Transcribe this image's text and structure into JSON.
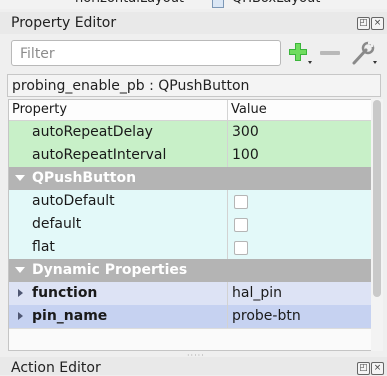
{
  "top_strip": {
    "tab1": "horizontalLayout",
    "tab2": "QHBoxLayout"
  },
  "property_editor": {
    "title": "Property Editor",
    "filter_placeholder": "Filter",
    "object_label": "probing_enable_pb : QPushButton",
    "columns": {
      "property": "Property",
      "value": "Value"
    },
    "rows": [
      {
        "name": "autoRepeatDelay",
        "value": "300"
      },
      {
        "name": "autoRepeatInterval",
        "value": "100"
      },
      {
        "name": "QPushButton",
        "value": ""
      },
      {
        "name": "autoDefault",
        "value": ""
      },
      {
        "name": "default",
        "value": ""
      },
      {
        "name": "flat",
        "value": ""
      },
      {
        "name": "Dynamic Properties",
        "value": ""
      },
      {
        "name": "function",
        "value": "hal_pin"
      },
      {
        "name": "pin_name",
        "value": "probe-btn"
      }
    ]
  },
  "action_editor": {
    "title": "Action Editor"
  },
  "colors": {
    "green_row": "#c8f0c8",
    "group_row": "#b4b4b4",
    "cyan_row": "#e3f9f9",
    "blue_row": "#c6d2f1"
  },
  "icons": {
    "add": "plus-icon",
    "remove": "minus-icon",
    "configure": "wrench-icon"
  }
}
